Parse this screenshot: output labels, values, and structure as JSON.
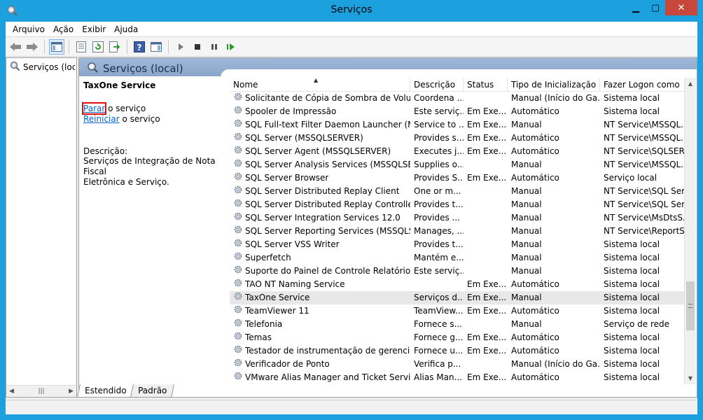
{
  "window": {
    "title": "Serviços"
  },
  "menu": [
    {
      "label": "Arquivo",
      "key": "A",
      "rest": "rquivo"
    },
    {
      "label": "Ação",
      "key": "",
      "rest": "Ação"
    },
    {
      "label": "Exibir",
      "key": "E",
      "rest": "xibir"
    },
    {
      "label": "Ajuda",
      "key": "",
      "rest": "Ajuda"
    }
  ],
  "tree": {
    "label": "Serviços (local)"
  },
  "pane": {
    "header": "Serviços (local)"
  },
  "detail": {
    "service_name": "TaxOne Service",
    "stop_link": "Parar",
    "stop_rest": " o serviço",
    "restart_link": "Reiniciar",
    "restart_rest": " o serviço",
    "description_label": "Descrição:",
    "description_line1": "Serviços de Integração de Nota Fiscal",
    "description_line2": "Eletrônica e Serviço."
  },
  "columns": [
    "Nome",
    "Descrição",
    "Status",
    "Tipo de Inicialização",
    "Fazer Logon como"
  ],
  "rows": [
    {
      "name": "Solicitante de Cópia de Sombra de Volume...",
      "desc": "Coordena ...",
      "status": "",
      "startup": "Manual (Início do Ga...",
      "logon": "Sistema local"
    },
    {
      "name": "Spooler de Impressão",
      "desc": "Este serviç...",
      "status": "Em Exe...",
      "startup": "Automático",
      "logon": "Sistema local"
    },
    {
      "name": "SQL Full-text Filter Daemon Launcher (MS...",
      "desc": "Service to ...",
      "status": "Em Exe...",
      "startup": "Manual",
      "logon": "NT Service\\MSSQL..."
    },
    {
      "name": "SQL Server (MSSQLSERVER)",
      "desc": "Provides s...",
      "status": "Em Exe...",
      "startup": "Automático",
      "logon": "NT Service\\MSSQL..."
    },
    {
      "name": "SQL Server Agent (MSSQLSERVER)",
      "desc": "Executes j...",
      "status": "Em Exe...",
      "startup": "Automático",
      "logon": "NT Service\\SQLSER..."
    },
    {
      "name": "SQL Server Analysis Services (MSSQLSERVE...",
      "desc": "Supplies o...",
      "status": "",
      "startup": "Manual",
      "logon": "NT Service\\MSSQL..."
    },
    {
      "name": "SQL Server Browser",
      "desc": "Provides S...",
      "status": "Em Exe...",
      "startup": "Automático",
      "logon": "Serviço local"
    },
    {
      "name": "SQL Server Distributed Replay Client",
      "desc": "One or m...",
      "status": "",
      "startup": "Manual",
      "logon": "NT Service\\SQL Ser..."
    },
    {
      "name": "SQL Server Distributed Replay Controller",
      "desc": "Provides t...",
      "status": "",
      "startup": "Manual",
      "logon": "NT Service\\SQL Ser..."
    },
    {
      "name": "SQL Server Integration Services 12.0",
      "desc": "Provides ...",
      "status": "",
      "startup": "Manual",
      "logon": "NT Service\\MsDtsS..."
    },
    {
      "name": "SQL Server Reporting Services (MSSQLSER...",
      "desc": "Manages, ...",
      "status": "",
      "startup": "Manual",
      "logon": "NT Service\\ReportS..."
    },
    {
      "name": "SQL Server VSS Writer",
      "desc": "Provides t...",
      "status": "",
      "startup": "Manual",
      "logon": "Sistema local"
    },
    {
      "name": "Superfetch",
      "desc": "Mantém e...",
      "status": "",
      "startup": "Manual",
      "logon": "Sistema local"
    },
    {
      "name": "Suporte do Painel de Controle Relatórios d...",
      "desc": "Este serviç...",
      "status": "",
      "startup": "Manual",
      "logon": "Sistema local"
    },
    {
      "name": "TAO NT Naming Service",
      "desc": "",
      "status": "Em Exe...",
      "startup": "Automático",
      "logon": "Sistema local"
    },
    {
      "name": "TaxOne Service",
      "desc": "Serviços d...",
      "status": "Em Exe...",
      "startup": "Manual",
      "logon": "Sistema local",
      "selected": true
    },
    {
      "name": "TeamViewer 11",
      "desc": "TeamView...",
      "status": "Em Exe...",
      "startup": "Automático",
      "logon": "Sistema local"
    },
    {
      "name": "Telefonia",
      "desc": "Fornece s...",
      "status": "",
      "startup": "Manual",
      "logon": "Serviço de rede"
    },
    {
      "name": "Temas",
      "desc": "Fornece g...",
      "status": "Em Exe...",
      "startup": "Automático",
      "logon": "Sistema local"
    },
    {
      "name": "Testador de instrumentação de gerenciam...",
      "desc": "Fornece u...",
      "status": "Em Exe...",
      "startup": "Automático",
      "logon": "Sistema local"
    },
    {
      "name": "Verificador de Ponto",
      "desc": "Verifica p...",
      "status": "",
      "startup": "Manual (Início do Ga...",
      "logon": "Sistema local"
    },
    {
      "name": "VMware Alias Manager and Ticket Service",
      "desc": "Alias Man...",
      "status": "Em Exe...",
      "startup": "Automático",
      "logon": "Sistema local"
    }
  ],
  "tabs": [
    "Estendido",
    "Padrão"
  ],
  "scroll": {
    "position_fraction": 0.82
  }
}
